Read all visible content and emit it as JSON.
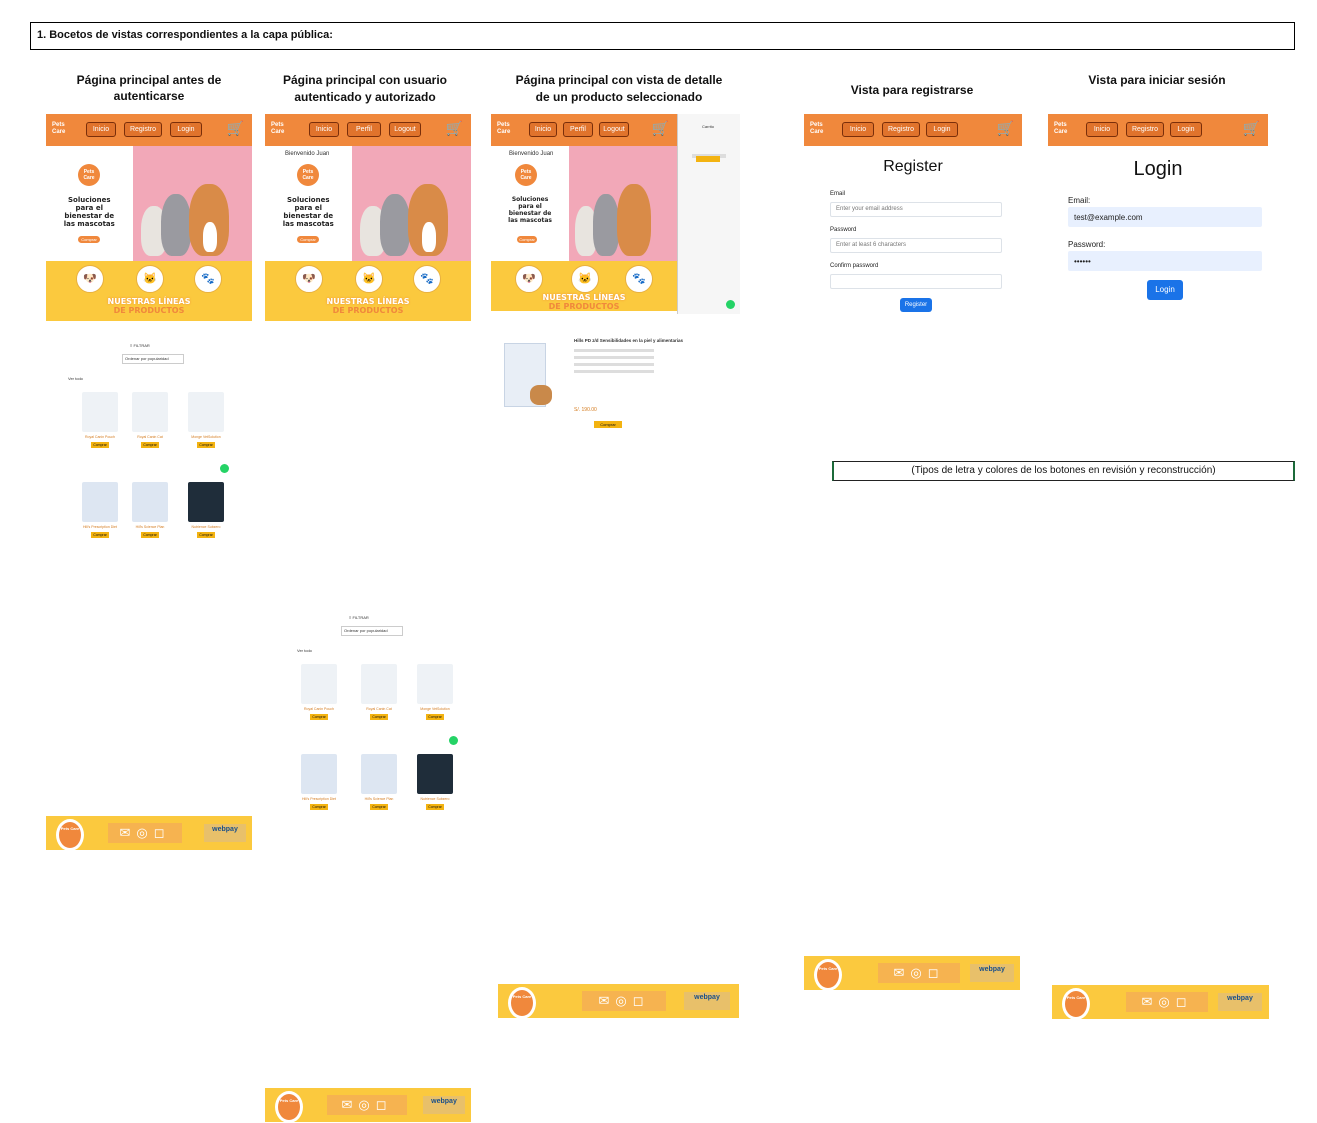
{
  "section": {
    "heading": "1.  Bocetos de vistas correspondientes a la capa pública:"
  },
  "columns": {
    "c1": "Página principal antes de autenticarse",
    "c2a": "Página principal con usuario",
    "c2b": "autenticado y autorizado",
    "c3a": "Página principal con vista de detalle",
    "c3b": "de un producto seleccionado",
    "c4": "Vista para registrarse",
    "c5": "Vista para iniciar sesión"
  },
  "nav": {
    "logo": "Pets Care",
    "inicio": "Inicio",
    "registro": "Registro",
    "login": "Login",
    "perfil": "Perfil",
    "logout": "Logout",
    "cart_icon": "cart-icon"
  },
  "hero": {
    "welcome": "Bienvenido Juan",
    "tagline1": "Soluciones",
    "tagline2": "para el",
    "tagline3": "bienestar de",
    "tagline4": "las mascotas",
    "cta": "Comprar"
  },
  "lines": {
    "line1": "NUESTRAS LÍNEAS",
    "line2": "DE PRODUCTOS"
  },
  "catalog": {
    "filter": "Ordenar por popularidad",
    "view_all": "Ver todo",
    "products": [
      {
        "title": "Royal Canin Pouch"
      },
      {
        "title": "Royal Canin Cat"
      },
      {
        "title": "Monge VetSolution"
      },
      {
        "title": "Hill's Prescription Diet"
      },
      {
        "title": "Hill's Science Plan"
      },
      {
        "title": "Nutrience Subzero"
      }
    ],
    "buy": "Comprar"
  },
  "detail": {
    "product_title": "Hills PD z/d Sensibilidades en la piel y alimentarias",
    "price": "S/. 190.00",
    "add": "Comprar"
  },
  "register": {
    "title": "Register",
    "email_label": "Email",
    "email_placeholder": "Enter your email address",
    "password_label": "Password",
    "password_placeholder": "Enter at least 6 characters",
    "confirm_label": "Confirm password",
    "button": "Register"
  },
  "login": {
    "title": "Login",
    "email_label": "Email:",
    "email_value": "test@example.com",
    "password_label": "Password:",
    "password_value": "••••••",
    "button": "Login"
  },
  "footer": {
    "pay": "webpay",
    "logo": "Pets Care"
  },
  "note": "(Tipos de letra  y colores de los botones en  revisión y reconstrucción)",
  "colors": {
    "orange": "#f0883c",
    "yellow": "#fbc93e",
    "pink": "#f2a8b8",
    "blue": "#1a73e8"
  }
}
